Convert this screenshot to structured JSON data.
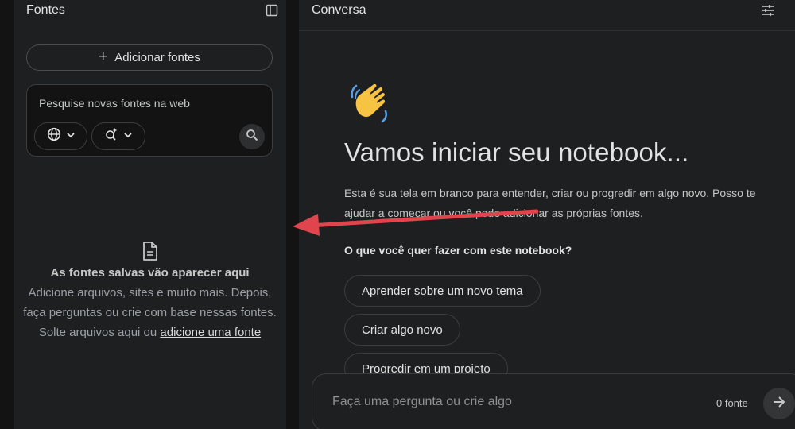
{
  "sources": {
    "title": "Fontes",
    "add_button_label": "Adicionar fontes",
    "search": {
      "placeholder": "Pesquise novas fontes na web",
      "chip_web_icon": "globe-icon",
      "chip_mode_icon": "sparkle-search-icon",
      "submit_icon": "search-icon"
    },
    "empty_state": {
      "icon": "document-icon",
      "title": "As fontes salvas vão aparecer aqui",
      "description": "Adicione arquivos, sites e muito mais. Depois, faça perguntas ou crie com base nessas fontes.",
      "drop_text": "Solte arquivos aqui ou ",
      "drop_link": "adicione uma fonte"
    }
  },
  "chat": {
    "title": "Conversa",
    "welcome_icon": "waving-hand-emoji",
    "welcome_title": "Vamos iniciar seu notebook...",
    "welcome_description": "Esta é sua tela em branco para entender, criar ou progredir em algo novo. Posso te ajudar a começar ou você pode adicionar as próprias fontes.",
    "question": "O que você quer fazer com este notebook?",
    "suggestions": [
      "Aprender sobre um novo tema",
      "Criar algo novo",
      "Progredir em um projeto"
    ],
    "composer": {
      "placeholder": "Faça uma pergunta ou crie algo",
      "source_count": "0 fonte",
      "send_icon": "arrow-right-icon"
    }
  },
  "colors": {
    "background": "#131314",
    "panel": "#1e1f20",
    "border": "#3c3d40",
    "annotation_arrow": "#e0454d"
  }
}
